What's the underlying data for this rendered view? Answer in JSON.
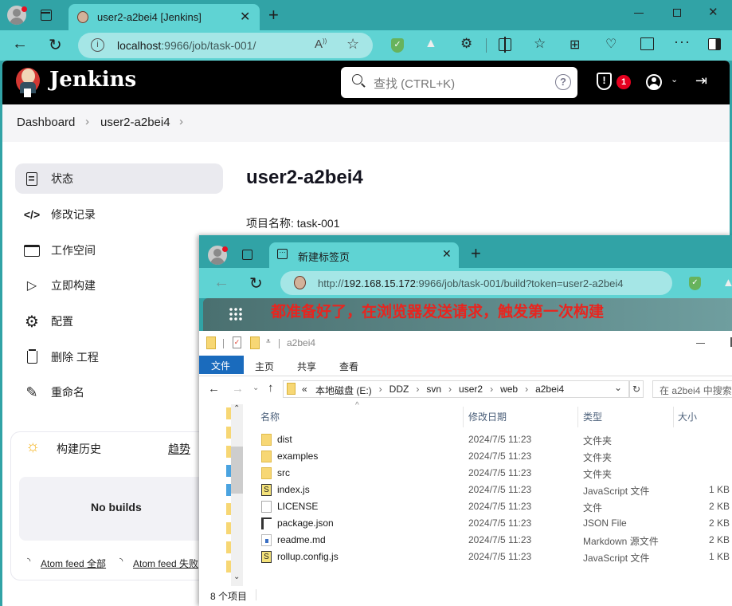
{
  "outer_browser": {
    "tab_title": "user2-a2bei4 [Jenkins]",
    "address": "localhost:9966/job/task-001/",
    "address_host": "localhost",
    "address_rest": ":9966/job/task-001/"
  },
  "jenkins": {
    "brand": "Jenkins",
    "search_placeholder": "查找 (CTRL+K)",
    "alert_count": "1",
    "breadcrumbs": [
      "Dashboard",
      "user2-a2bei4"
    ],
    "page_title": "user2-a2bei4",
    "project_name_label": "项目名称: task-001",
    "sidebar": [
      {
        "label": "状态",
        "icon": "document-icon",
        "active": true
      },
      {
        "label": "修改记录",
        "icon": "code-icon"
      },
      {
        "label": "工作空间",
        "icon": "folder-icon"
      },
      {
        "label": "立即构建",
        "icon": "play-icon"
      },
      {
        "label": "配置",
        "icon": "gear-icon"
      },
      {
        "label": "删除 工程",
        "icon": "trash-icon"
      },
      {
        "label": "重命名",
        "icon": "pencil-icon"
      }
    ],
    "build_history": {
      "title": "构建历史",
      "trend_link": "趋势",
      "empty_text": "No builds",
      "feed_all": "Atom feed 全部",
      "feed_failed": "Atom feed 失败"
    }
  },
  "inner_browser": {
    "tab_title": "新建标签页",
    "address_prefix": "http://",
    "address_host": "192.168.15.172",
    "address_rest": ":9966/job/task-001/build?token=user2-a2bei4",
    "annotation": "都准备好了，在浏览器发送请求，触发第一次构建",
    "annotation_color": "#e8251f"
  },
  "explorer": {
    "title": "a2bei4",
    "ribbon_tabs": [
      "文件",
      "主页",
      "共享",
      "查看"
    ],
    "path": [
      "本地磁盘 (E:)",
      "DDZ",
      "svn",
      "user2",
      "web",
      "a2bei4"
    ],
    "search_placeholder": "在 a2bei4 中搜索",
    "columns": [
      "名称",
      "修改日期",
      "类型",
      "大小"
    ],
    "files": [
      {
        "name": "dist",
        "date": "2024/7/5 11:23",
        "type": "文件夹",
        "size": "",
        "icon": "folder"
      },
      {
        "name": "examples",
        "date": "2024/7/5 11:23",
        "type": "文件夹",
        "size": "",
        "icon": "folder"
      },
      {
        "name": "src",
        "date": "2024/7/5 11:23",
        "type": "文件夹",
        "size": "",
        "icon": "folder"
      },
      {
        "name": "index.js",
        "date": "2024/7/5 11:23",
        "type": "JavaScript 文件",
        "size": "1 KB",
        "icon": "js"
      },
      {
        "name": "LICENSE",
        "date": "2024/7/5 11:23",
        "type": "文件",
        "size": "2 KB",
        "icon": "file"
      },
      {
        "name": "package.json",
        "date": "2024/7/5 11:23",
        "type": "JSON File",
        "size": "2 KB",
        "icon": "json"
      },
      {
        "name": "readme.md",
        "date": "2024/7/5 11:23",
        "type": "Markdown 源文件",
        "size": "2 KB",
        "icon": "md"
      },
      {
        "name": "rollup.config.js",
        "date": "2024/7/5 11:23",
        "type": "JavaScript 文件",
        "size": "1 KB",
        "icon": "js"
      }
    ],
    "status": "8 个项目"
  }
}
